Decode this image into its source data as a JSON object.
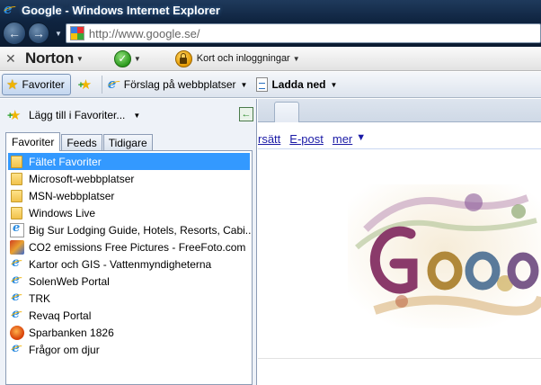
{
  "window": {
    "title": "Google - Windows Internet Explorer"
  },
  "address_bar": {
    "url": "http://www.google.se/",
    "favicon": "google-favicon"
  },
  "navigation": {
    "back_icon": "back-arrow-icon",
    "forward_icon": "forward-arrow-icon"
  },
  "norton_toolbar": {
    "logo": "Norton",
    "safe_icon": "checkmark-icon",
    "identity_label": "Kort och inloggningar"
  },
  "favorites_bar": {
    "favorites_button": "Favoriter",
    "suggested_sites": "Förslag på webbplatser",
    "downloads": "Ladda ned"
  },
  "favorites_center": {
    "add_label": "Lägg till i Favoriter...",
    "tabs": [
      {
        "label": "Favoriter",
        "active": true
      },
      {
        "label": "Feeds",
        "active": false
      },
      {
        "label": "Tidigare",
        "active": false
      }
    ],
    "items": [
      {
        "label": "Fältet Favoriter",
        "icon": "folder-icon",
        "selected": true
      },
      {
        "label": "Microsoft-webbplatser",
        "icon": "folder-icon"
      },
      {
        "label": "MSN-webbplatser",
        "icon": "folder-icon"
      },
      {
        "label": "Windows Live",
        "icon": "folder-icon"
      },
      {
        "label": "Big Sur Lodging Guide, Hotels, Resorts, Cabi...",
        "icon": "page-icon"
      },
      {
        "label": "CO2 emissions Free Pictures - FreeFoto.com",
        "icon": "freefoto-icon"
      },
      {
        "label": "Kartor och GIS - Vattenmyndigheterna",
        "icon": "ie-icon"
      },
      {
        "label": "SolenWeb Portal",
        "icon": "ie-icon"
      },
      {
        "label": "TRK",
        "icon": "ie-icon"
      },
      {
        "label": "Revaq Portal",
        "icon": "ie-icon"
      },
      {
        "label": "Sparbanken 1826",
        "icon": "sparbanken-icon"
      },
      {
        "label": "Frågor om djur",
        "icon": "ie-icon"
      }
    ]
  },
  "page": {
    "links": [
      "rsätt",
      "E-post",
      "mer"
    ],
    "doodle": "google-doodle-logo"
  },
  "colors": {
    "selection": "#3399ff",
    "link": "#1a1aa6"
  }
}
